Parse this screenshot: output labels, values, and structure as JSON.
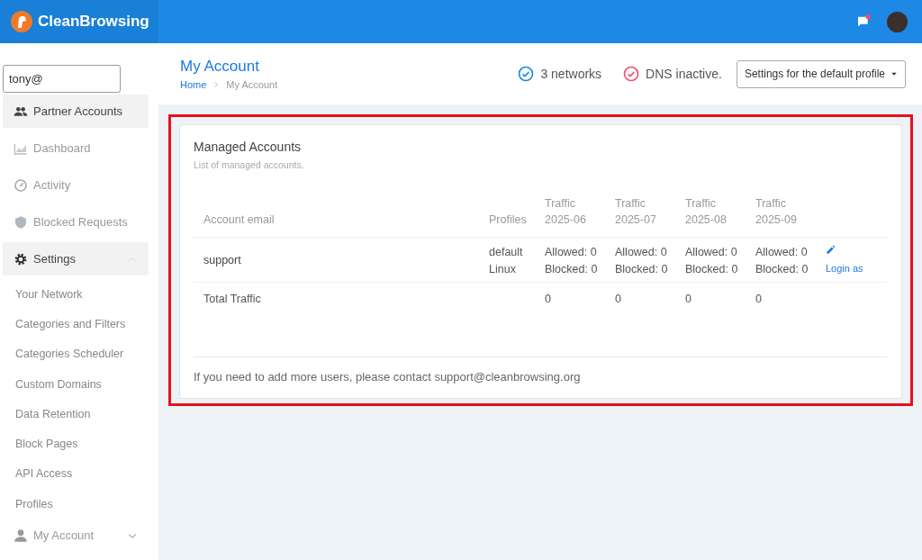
{
  "topbar": {
    "brand": "CleanBrowsing",
    "notification": true
  },
  "sidebar": {
    "search": {
      "value": "tony@"
    },
    "items": [
      {
        "label": "Partner Accounts",
        "selected": true
      },
      {
        "label": "Dashboard",
        "selected": false
      },
      {
        "label": "Activity",
        "selected": false
      },
      {
        "label": "Blocked Requests",
        "selected": false
      },
      {
        "label": "Settings",
        "expanded": true,
        "children": [
          {
            "label": "Your Network"
          },
          {
            "label": "Categories and Filters"
          },
          {
            "label": "Categories Scheduler"
          },
          {
            "label": "Custom Domains"
          },
          {
            "label": "Data Retention"
          },
          {
            "label": "Block Pages"
          },
          {
            "label": "API Access"
          },
          {
            "label": "Profiles"
          }
        ]
      },
      {
        "label": "My Account",
        "expanded": false
      }
    ]
  },
  "header": {
    "title": "My Account",
    "breadcrumb": [
      "Home",
      "My Account"
    ],
    "statuses": [
      {
        "text": "3 networks",
        "color": "#1e88e5"
      },
      {
        "text": "DNS inactive.",
        "color": "#f0506e"
      }
    ],
    "profile_button": "Settings for the default profile"
  },
  "card": {
    "title": "Managed Accounts",
    "subtitle": "List of managed accounts.",
    "table": {
      "columns": [
        "Account email",
        "Profiles",
        "Traffic 2025-06",
        "Traffic 2025-07",
        "Traffic 2025-08",
        "Traffic 2025-09"
      ],
      "rows": [
        {
          "email": "support",
          "profiles": [
            "default",
            "Linux"
          ],
          "traffic": [
            [
              "Allowed: 0",
              "Blocked: 0"
            ],
            [
              "Allowed: 0",
              "Blocked: 0"
            ],
            [
              "Allowed: 0",
              "Blocked: 0"
            ],
            [
              "Allowed: 0",
              "Blocked: 0"
            ]
          ],
          "action": "Login as"
        }
      ],
      "total": {
        "label": "Total Traffic",
        "values": [
          "0",
          "0",
          "0",
          "0"
        ]
      }
    },
    "footer": "If you need to add more users, please contact support@cleanbrowsing.org"
  }
}
